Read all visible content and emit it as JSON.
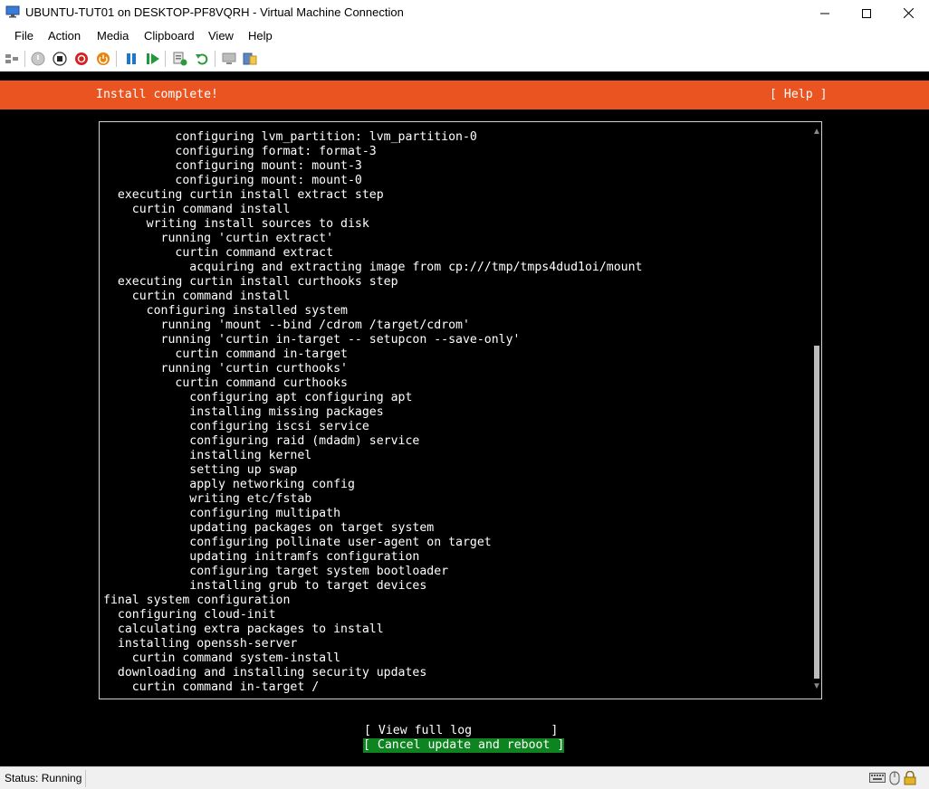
{
  "window": {
    "title": "UBUNTU-TUT01 on DESKTOP-PF8VQRH - Virtual Machine Connection",
    "minimize_glyph": "—",
    "maximize_glyph": "☐",
    "close_glyph": "✕"
  },
  "menu": {
    "items": [
      "File",
      "Action",
      "Media",
      "Clipboard",
      "View",
      "Help"
    ]
  },
  "toolbar": {
    "icons": [
      "ctrl-alt-del-icon",
      "start-icon",
      "turn-off-icon",
      "shut-down-icon",
      "save-icon",
      "pause-icon",
      "resume-icon",
      "checkpoint-icon",
      "revert-icon",
      "enhanced-session-icon",
      "share-icon"
    ]
  },
  "installer": {
    "header_title": "Install complete!",
    "help_label": "[ Help ]",
    "accent_color": "#e95420",
    "log_lines": [
      "          configuring lvm_partition: lvm_partition-0",
      "          configuring format: format-3",
      "          configuring mount: mount-3",
      "          configuring mount: mount-0",
      "  executing curtin install extract step",
      "    curtin command install",
      "      writing install sources to disk",
      "        running 'curtin extract'",
      "          curtin command extract",
      "            acquiring and extracting image from cp:///tmp/tmps4dud1oi/mount",
      "  executing curtin install curthooks step",
      "    curtin command install",
      "      configuring installed system",
      "        running 'mount --bind /cdrom /target/cdrom'",
      "        running 'curtin in-target -- setupcon --save-only'",
      "          curtin command in-target",
      "        running 'curtin curthooks'",
      "          curtin command curthooks",
      "            configuring apt configuring apt",
      "            installing missing packages",
      "            configuring iscsi service",
      "            configuring raid (mdadm) service",
      "            installing kernel",
      "            setting up swap",
      "            apply networking config",
      "            writing etc/fstab",
      "            configuring multipath",
      "            updating packages on target system",
      "            configuring pollinate user-agent on target",
      "            updating initramfs configuration",
      "            configuring target system bootloader",
      "            installing grub to target devices",
      "final system configuration",
      "  configuring cloud-init",
      "  calculating extra packages to install",
      "  installing openssh-server",
      "    curtin command system-install",
      "  downloading and installing security updates",
      "    curtin command in-target /"
    ],
    "view_log_label": "[ View full log           ]",
    "cancel_reboot_label": "[ Cancel update and reboot ]",
    "cancel_button_color": "#0e8420"
  },
  "status": {
    "text": "Status: Running"
  }
}
